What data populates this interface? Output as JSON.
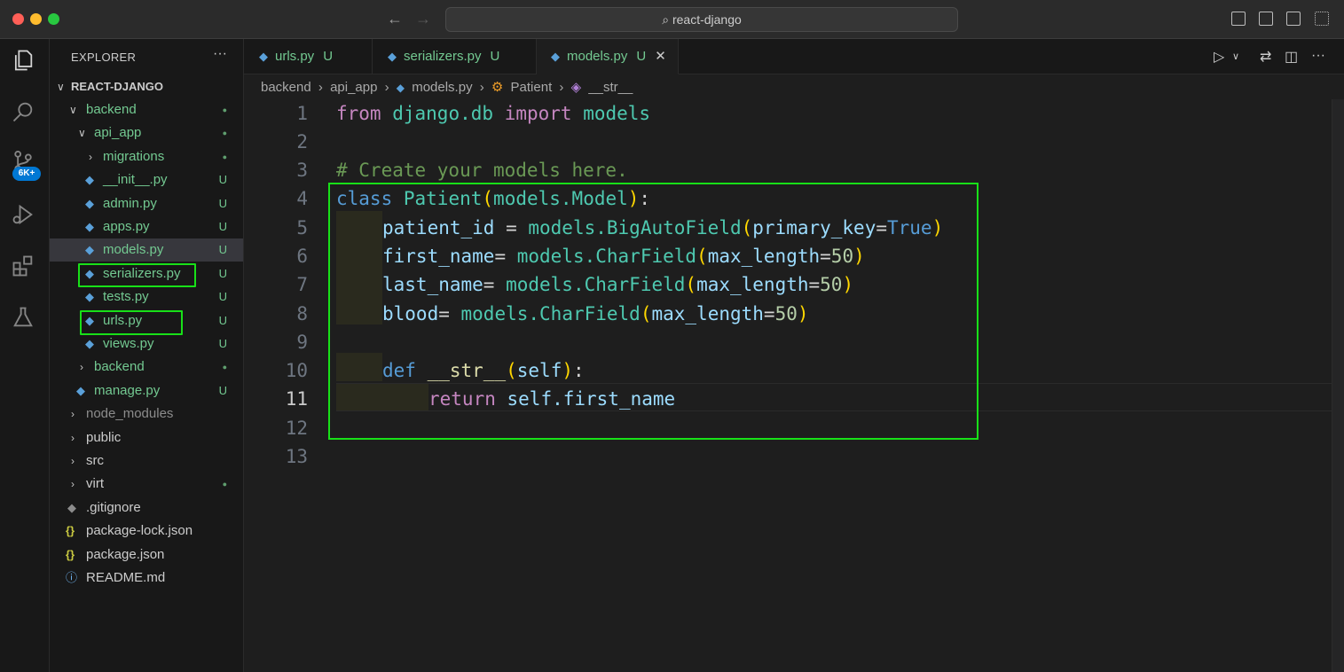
{
  "window": {
    "search": "react-django"
  },
  "explorer": {
    "title": "EXPLORER",
    "more": "···",
    "root": "REACT-DJANGO",
    "items": [
      {
        "label": "backend",
        "status": "●"
      },
      {
        "label": "api_app",
        "status": "●"
      },
      {
        "label": "migrations",
        "status": "●"
      },
      {
        "label": "__init__.py",
        "status": "U"
      },
      {
        "label": "admin.py",
        "status": "U"
      },
      {
        "label": "apps.py",
        "status": "U"
      },
      {
        "label": "models.py",
        "status": "U"
      },
      {
        "label": "serializers.py",
        "status": "U"
      },
      {
        "label": "tests.py",
        "status": "U"
      },
      {
        "label": "urls.py",
        "status": "U"
      },
      {
        "label": "views.py",
        "status": "U"
      },
      {
        "label": "backend",
        "status": "●"
      },
      {
        "label": "manage.py",
        "status": "U"
      },
      {
        "label": "node_modules",
        "status": ""
      },
      {
        "label": "public",
        "status": ""
      },
      {
        "label": "src",
        "status": ""
      },
      {
        "label": "virt",
        "status": "●"
      },
      {
        "label": ".gitignore",
        "status": ""
      },
      {
        "label": "package-lock.json",
        "status": ""
      },
      {
        "label": "package.json",
        "status": ""
      },
      {
        "label": "README.md",
        "status": ""
      }
    ]
  },
  "activity": {
    "badge": "6K+"
  },
  "tabs": [
    {
      "label": "urls.py",
      "status": "U"
    },
    {
      "label": "serializers.py",
      "status": "U"
    },
    {
      "label": "models.py",
      "status": "U",
      "close": "✕"
    }
  ],
  "breadcrumb": {
    "parts": [
      "backend",
      "api_app",
      "models.py",
      "Patient",
      "__str__"
    ],
    "sep": "›"
  },
  "editor": {
    "line_numbers": [
      "1",
      "2",
      "3",
      "4",
      "5",
      "6",
      "7",
      "8",
      "9",
      "10",
      "11",
      "12",
      "13"
    ],
    "current_line": 11,
    "code": {
      "l1": {
        "kw": "from",
        "mod": "django.db",
        "kw2": "import",
        "name": "models"
      },
      "l3": "# Create your models here.",
      "l4": {
        "kw": "class",
        "name": "Patient",
        "base": "models.Model"
      },
      "l5": {
        "field": "patient_id",
        "eq": " = ",
        "mod": "models.",
        "fn": "BigAutoField",
        "arg": "primary_key",
        "val": "True"
      },
      "l6": {
        "field": "first_name",
        "eq": "= ",
        "mod": "models.",
        "fn": "CharField",
        "arg": "max_length",
        "val": "50"
      },
      "l7": {
        "field": "last_name",
        "eq": "= ",
        "mod": "models.",
        "fn": "CharField",
        "arg": "max_length",
        "val": "50"
      },
      "l8": {
        "field": "blood",
        "eq": "= ",
        "mod": "models.",
        "fn": "CharField",
        "arg": "max_length",
        "val": "50"
      },
      "l10": {
        "kw": "def",
        "fn": "__str__",
        "arg": "self"
      },
      "l11": {
        "kw": "return",
        "expr": "self.first_name"
      }
    }
  },
  "colors": {
    "highlight": "#18e018",
    "untracked": "#73c991",
    "accent": "#0078d4"
  }
}
